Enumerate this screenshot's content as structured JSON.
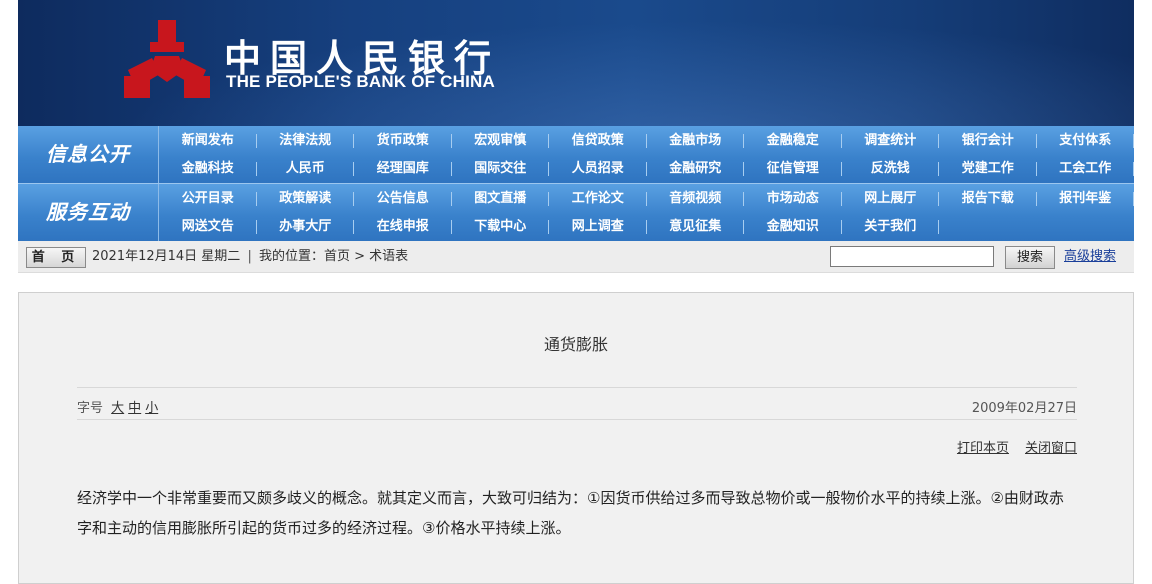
{
  "header": {
    "cn_name": "中国人民银行",
    "en_name": "THE PEOPLE'S BANK OF CHINA"
  },
  "nav": {
    "group1": {
      "label": "信息公开",
      "row1": [
        "新闻发布",
        "法律法规",
        "货币政策",
        "宏观审慎",
        "信贷政策",
        "金融市场",
        "金融稳定",
        "调查统计",
        "银行会计",
        "支付体系"
      ],
      "row2": [
        "金融科技",
        "人民币",
        "经理国库",
        "国际交往",
        "人员招录",
        "金融研究",
        "征信管理",
        "反洗钱",
        "党建工作",
        "工会工作"
      ]
    },
    "group2": {
      "label": "服务互动",
      "row1": [
        "公开目录",
        "政策解读",
        "公告信息",
        "图文直播",
        "工作论文",
        "音频视频",
        "市场动态",
        "网上展厅",
        "报告下载",
        "报刊年鉴"
      ],
      "row2": [
        "网送文告",
        "办事大厅",
        "在线申报",
        "下载中心",
        "网上调查",
        "意见征集",
        "金融知识",
        "关于我们"
      ]
    }
  },
  "locbar": {
    "home": "首 页",
    "date": "2021年12月14日 星期二",
    "sep": "|",
    "location": "我的位置：首页 > 术语表",
    "search_value": "",
    "search_button": "搜索",
    "advanced_search": "高级搜索"
  },
  "article": {
    "title": "通货膨胀",
    "fontsize_label": "字号",
    "font_large": "大",
    "font_medium": "中",
    "font_small": "小",
    "date": "2009年02月27日",
    "print": "打印本页",
    "close": "关闭窗口",
    "body": "经济学中一个非常重要而又颇多歧义的概念。就其定义而言，大致可归结为：①因货币供给过多而导致总物价或一般物价水平的持续上涨。②由财政赤字和主动的信用膨胀所引起的货币过多的经济过程。③价格水平持续上涨。"
  },
  "colors": {
    "banner": "#16407f",
    "nav": "#3e86cf",
    "logo_red": "#c8161d",
    "link": "#1a3f9a"
  }
}
